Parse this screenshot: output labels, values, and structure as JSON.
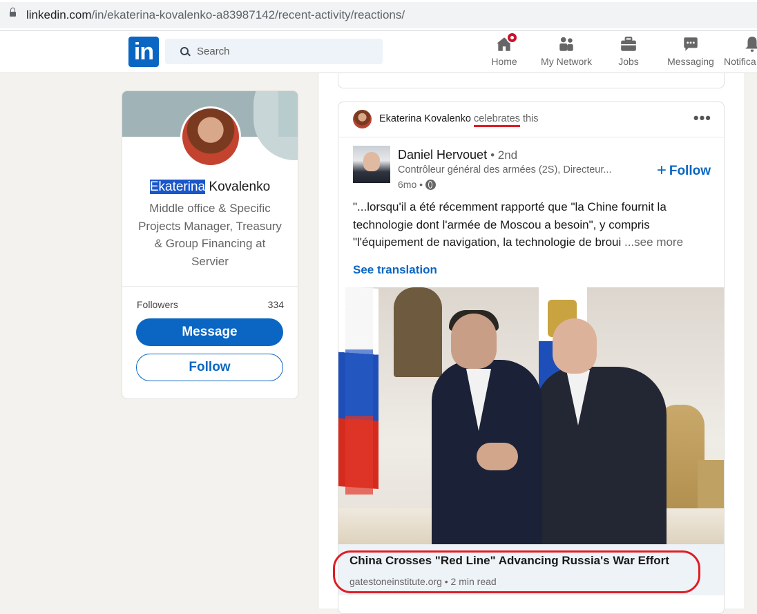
{
  "browser": {
    "url_host": "linkedin.com",
    "url_path": "/in/ekaterina-kovalenko-a83987142/recent-activity/reactions/"
  },
  "nav": {
    "logo": "in",
    "search_placeholder": "Search",
    "items": [
      {
        "label": "Home",
        "icon": "home-icon"
      },
      {
        "label": "My Network",
        "icon": "network-icon"
      },
      {
        "label": "Jobs",
        "icon": "briefcase-icon"
      },
      {
        "label": "Messaging",
        "icon": "messaging-icon"
      },
      {
        "label": "Notifica",
        "icon": "bell-icon"
      }
    ]
  },
  "profile": {
    "first_name": "Ekaterina",
    "last_name": "Kovalenko",
    "headline": "Middle office & Specific Projects Manager, Treasury & Group Financing at Servier",
    "followers_label": "Followers",
    "followers_count": "334",
    "message_label": "Message",
    "follow_label": "Follow"
  },
  "post": {
    "reactor": "Ekaterina Kovalenko",
    "reaction_verb": "celebrates",
    "reaction_tail": "this",
    "author": "Daniel Hervouet",
    "degree": "• 2nd",
    "subtitle": "Contrôleur général des armées (2S), Directeur...",
    "time": "6mo •",
    "follow_label": "Follow",
    "text": "\"...lorsqu'il a été récemment rapporté que \"la Chine fournit la technologie dont l'armée de Moscou a besoin\", y compris \"l'équipement de navigation, la technologie de broui",
    "see_more": "...see more",
    "see_translation": "See translation",
    "article_title": "China Crosses \"Red Line\" Advancing Russia's War Effort",
    "article_source": "gatestoneinstitute.org • 2 min read"
  },
  "colors": {
    "brand": "#0a66c2",
    "annotation_red": "#e01c24",
    "name_highlight": "#1a56c9"
  }
}
